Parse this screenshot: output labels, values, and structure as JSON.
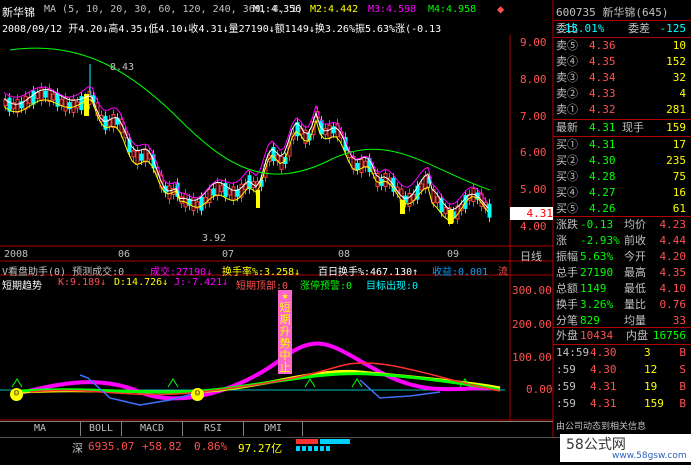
{
  "stock": {
    "name": "新华锦",
    "code_name": "600735 新华锦(645)"
  },
  "ma_legend": {
    "label": "MA (5, 10, 20, 30, 60, 120, 240, 360, 4, 1)",
    "m1": "M1:4.356",
    "m2": "M2:4.442",
    "m3": "M3:4.598",
    "m4": "M4:4.958"
  },
  "ohlc_line": "2008/09/12  开4.20↓高4.35↓低4.10↓收4.31↓量27190↓额1149↓换3.26%振5.63%涨(-0.13",
  "price_axis": [
    "9.00",
    "8.00",
    "7.00",
    "6.00",
    "5.00",
    "4.00"
  ],
  "price_labels": {
    "high": "8.43",
    "low": "3.92",
    "current": "4.31"
  },
  "date_axis": [
    "2008",
    "06",
    "07",
    "08",
    "09"
  ],
  "period_label": "日线",
  "indicator1": {
    "title": "V看盘助手(0)  预测成交:0",
    "vol": "成交:27190↓",
    "turnover": "换手率%:3.258↓",
    "hundred": "百日换手%:467.130↑",
    "income": "收益:0.001",
    "flow": "流"
  },
  "indicator2": {
    "title": "短期趋势",
    "k": "K:9.189↓",
    "d": "D:14.726↓",
    "j": "J:-7.421↓",
    "top": "短期顶部:0",
    "warn": "涨停预警:0",
    "target": "目标出现:0"
  },
  "vertical_text": "★短期升势中止",
  "indicator_axis": [
    "300.00",
    "200.00",
    "100.00",
    "0.00"
  ],
  "tabs": [
    "MA",
    "BOLL",
    "MACD",
    "RSI",
    "DMI"
  ],
  "status_bar": {
    "market": "深",
    "index": "6935.07",
    "change": "+58.82",
    "pct": "0.86%",
    "amount": "97.27亿"
  },
  "watermark": {
    "logo": "58公式网",
    "url": "www.58gsw.com"
  },
  "quote_panel": {
    "weibi": "委比",
    "weibi_val": "-15.01%",
    "weicha": "委差",
    "weicha_val": "-125",
    "sell": [
      {
        "label": "卖⑤",
        "price": "4.36",
        "vol": "10"
      },
      {
        "label": "卖④",
        "price": "4.35",
        "vol": "152"
      },
      {
        "label": "卖③",
        "price": "4.34",
        "vol": "32"
      },
      {
        "label": "卖②",
        "price": "4.33",
        "vol": "4"
      },
      {
        "label": "卖①",
        "price": "4.32",
        "vol": "281"
      }
    ],
    "latest_label": "最新",
    "latest": "4.31",
    "xianshou_label": "现手",
    "xianshou": "159",
    "buy": [
      {
        "label": "买①",
        "price": "4.31",
        "vol": "17"
      },
      {
        "label": "买②",
        "price": "4.30",
        "vol": "235"
      },
      {
        "label": "买③",
        "price": "4.28",
        "vol": "75"
      },
      {
        "label": "买④",
        "price": "4.27",
        "vol": "16"
      },
      {
        "label": "买⑤",
        "price": "4.26",
        "vol": "61"
      }
    ],
    "stats": [
      {
        "a": "涨跌",
        "av": "-0.13",
        "b": "均价",
        "bv": "4.23"
      },
      {
        "a": "涨",
        "av": "-2.93%",
        "b": "前收",
        "bv": "4.44"
      },
      {
        "a": "振幅",
        "av": "5.63%",
        "b": "今开",
        "bv": "4.20"
      },
      {
        "a": "总手",
        "av": "27190",
        "b": "最高",
        "bv": "4.35"
      },
      {
        "a": "总额",
        "av": "1149",
        "b": "最低",
        "bv": "4.10"
      },
      {
        "a": "换手",
        "av": "3.26%",
        "b": "量比",
        "bv": "0.76"
      },
      {
        "a": "分笔",
        "av": "829",
        "b": "均量",
        "bv": "33"
      }
    ],
    "outer_label": "外盘",
    "outer": "10434",
    "inner_label": "内盘",
    "inner": "16756",
    "ticks": [
      {
        "time": "14:59",
        "price": "4.30",
        "vol": "3",
        "side": "B"
      },
      {
        "time": ":59",
        "price": "4.30",
        "vol": "12",
        "side": "S"
      },
      {
        "time": ":59",
        "price": "4.31",
        "vol": "19",
        "side": "B"
      },
      {
        "time": ":59",
        "price": "4.31",
        "vol": "159",
        "side": "B"
      }
    ],
    "footer": "由公司动态到相关信息"
  }
}
